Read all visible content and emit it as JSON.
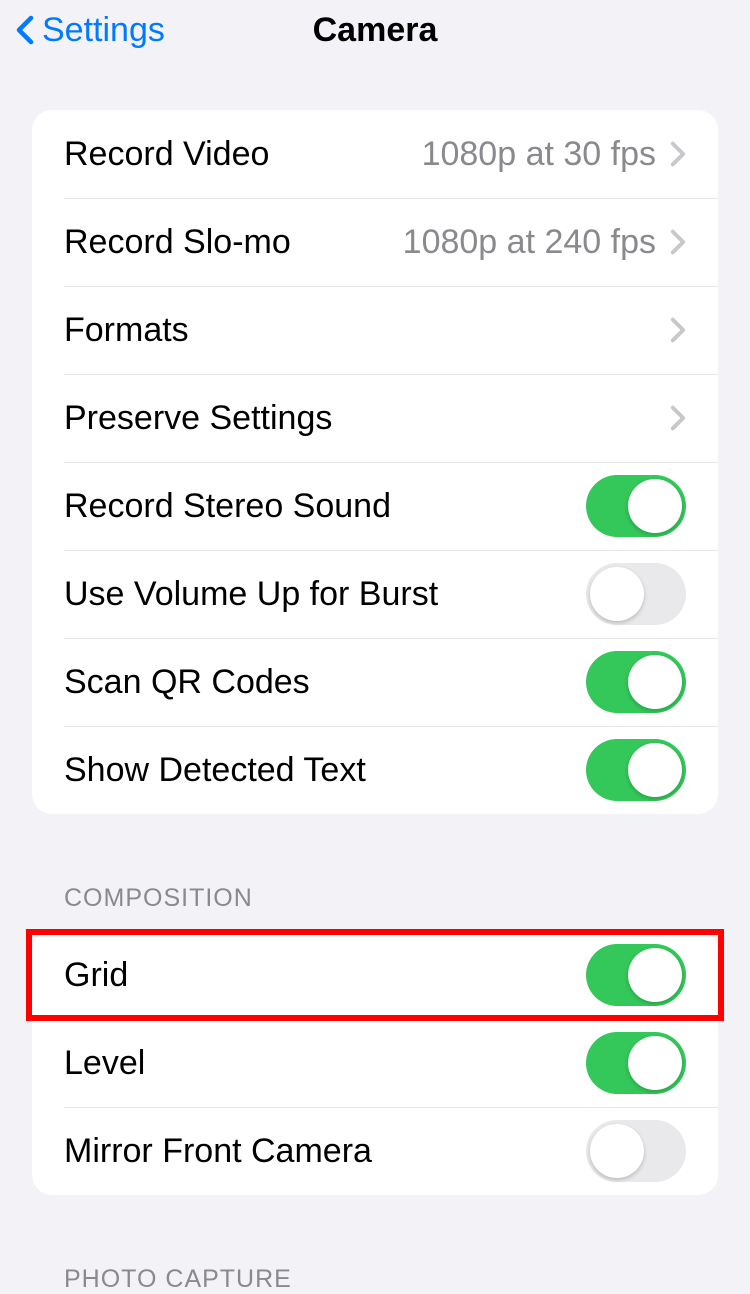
{
  "nav": {
    "back_label": "Settings",
    "title": "Camera"
  },
  "group1": {
    "rows": [
      {
        "name": "record-video",
        "label": "Record Video",
        "value": "1080p at 30 fps",
        "type": "nav"
      },
      {
        "name": "record-slomo",
        "label": "Record Slo-mo",
        "value": "1080p at 240 fps",
        "type": "nav"
      },
      {
        "name": "formats",
        "label": "Formats",
        "value": "",
        "type": "nav"
      },
      {
        "name": "preserve-settings",
        "label": "Preserve Settings",
        "value": "",
        "type": "nav"
      },
      {
        "name": "record-stereo-sound",
        "label": "Record Stereo Sound",
        "type": "toggle",
        "on": true
      },
      {
        "name": "use-volume-up-burst",
        "label": "Use Volume Up for Burst",
        "type": "toggle",
        "on": false
      },
      {
        "name": "scan-qr-codes",
        "label": "Scan QR Codes",
        "type": "toggle",
        "on": true
      },
      {
        "name": "show-detected-text",
        "label": "Show Detected Text",
        "type": "toggle",
        "on": true
      }
    ]
  },
  "group2": {
    "header": "Composition",
    "rows": [
      {
        "name": "grid",
        "label": "Grid",
        "type": "toggle",
        "on": true,
        "highlighted": true
      },
      {
        "name": "level",
        "label": "Level",
        "type": "toggle",
        "on": true
      },
      {
        "name": "mirror-front-camera",
        "label": "Mirror Front Camera",
        "type": "toggle",
        "on": false
      }
    ]
  },
  "below_header": "Photo Capture"
}
